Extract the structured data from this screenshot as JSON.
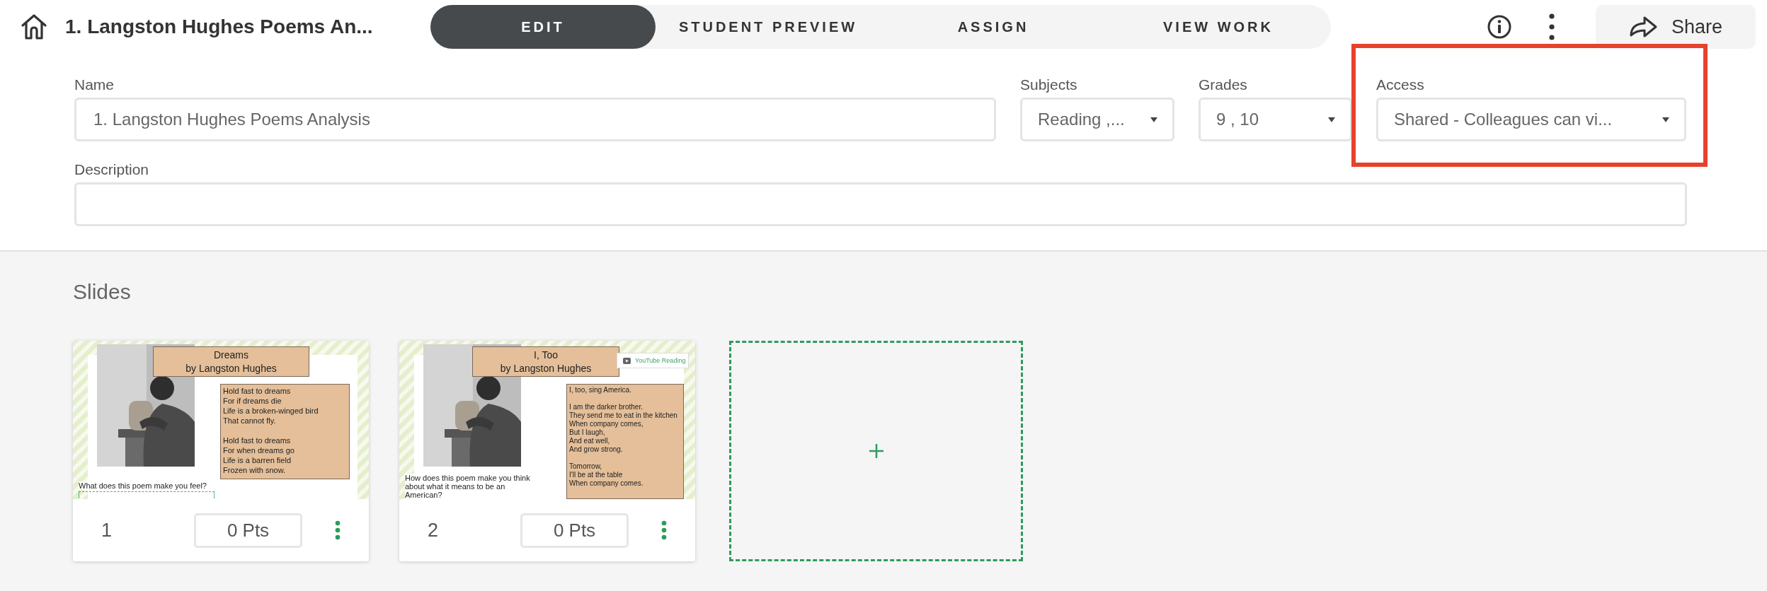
{
  "header": {
    "title": "1. Langston Hughes Poems An...",
    "share_label": "Share",
    "tabs": [
      {
        "label": "EDIT",
        "selected": true
      },
      {
        "label": "STUDENT PREVIEW",
        "selected": false
      },
      {
        "label": "ASSIGN",
        "selected": false
      },
      {
        "label": "VIEW WORK",
        "selected": false
      }
    ]
  },
  "form": {
    "name": {
      "label": "Name",
      "value": "1. Langston Hughes Poems Analysis"
    },
    "subjects": {
      "label": "Subjects",
      "value": "Reading ,..."
    },
    "grades": {
      "label": "Grades",
      "value": "9 , 10"
    },
    "access": {
      "label": "Access",
      "value": "Shared - Colleagues can vi...",
      "highlighted": true
    },
    "description": {
      "label": "Description"
    }
  },
  "slides": {
    "heading": "Slides",
    "items": [
      {
        "number": "1",
        "points": "0 Pts",
        "title_lines": [
          "Dreams",
          "by Langston Hughes"
        ],
        "poem": [
          [
            "Hold fast to dreams",
            "For if dreams die",
            "Life is a broken-winged bird",
            "That cannot fly."
          ],
          [
            "Hold fast to dreams",
            "For when dreams go",
            "Life is a barren field",
            "Frozen with snow."
          ]
        ],
        "question": "What does this poem make you feel?",
        "answer_box": true
      },
      {
        "number": "2",
        "points": "0 Pts",
        "title_lines": [
          "I, Too",
          "by Langston Hughes"
        ],
        "poem": [
          [
            "I, too, sing America."
          ],
          [
            "I am the darker brother.",
            "They send me to eat in the kitchen",
            "When company comes,",
            "But I laugh,",
            "And eat well,",
            "And grow strong."
          ],
          [
            "Tomorrow,",
            "I'll be at the table",
            "When company comes."
          ]
        ],
        "question": "How does this poem make you think about what it means to be an American?",
        "link": "YouTube Reading",
        "answer_box": false
      }
    ]
  }
}
